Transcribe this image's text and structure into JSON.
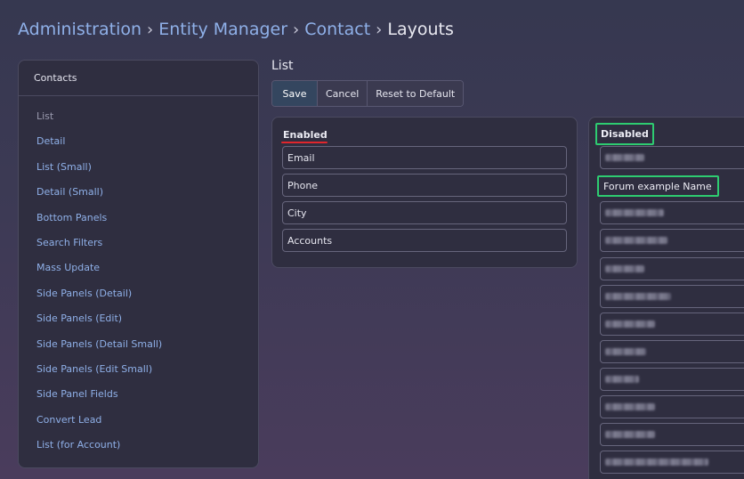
{
  "breadcrumb": {
    "items": [
      "Administration",
      "Entity Manager",
      "Contact"
    ],
    "separator": "›",
    "current": "Layouts"
  },
  "sidebar": {
    "title": "Contacts",
    "items": [
      {
        "label": "List",
        "active": true
      },
      {
        "label": "Detail"
      },
      {
        "label": "List (Small)"
      },
      {
        "label": "Detail (Small)"
      },
      {
        "label": "Bottom Panels"
      },
      {
        "label": "Search Filters"
      },
      {
        "label": "Mass Update"
      },
      {
        "label": "Side Panels (Detail)"
      },
      {
        "label": "Side Panels (Edit)"
      },
      {
        "label": "Side Panels (Detail Small)"
      },
      {
        "label": "Side Panels (Edit Small)"
      },
      {
        "label": "Side Panel Fields"
      },
      {
        "label": "Convert Lead"
      },
      {
        "label": "List (for Account)"
      }
    ]
  },
  "main": {
    "section_title": "List",
    "buttons": {
      "save": "Save",
      "cancel": "Cancel",
      "reset": "Reset to Default"
    },
    "enabled": {
      "label": "Enabled",
      "fields": [
        "Email",
        "Phone",
        "City",
        "Accounts"
      ]
    },
    "disabled": {
      "label": "Disabled",
      "highlighted_field": "Forum example Name"
    }
  },
  "colors": {
    "link": "#8fb0e8",
    "highlight_box": "#2ecc71",
    "enabled_underline": "#e0262c",
    "primary_button": "#34465f"
  }
}
